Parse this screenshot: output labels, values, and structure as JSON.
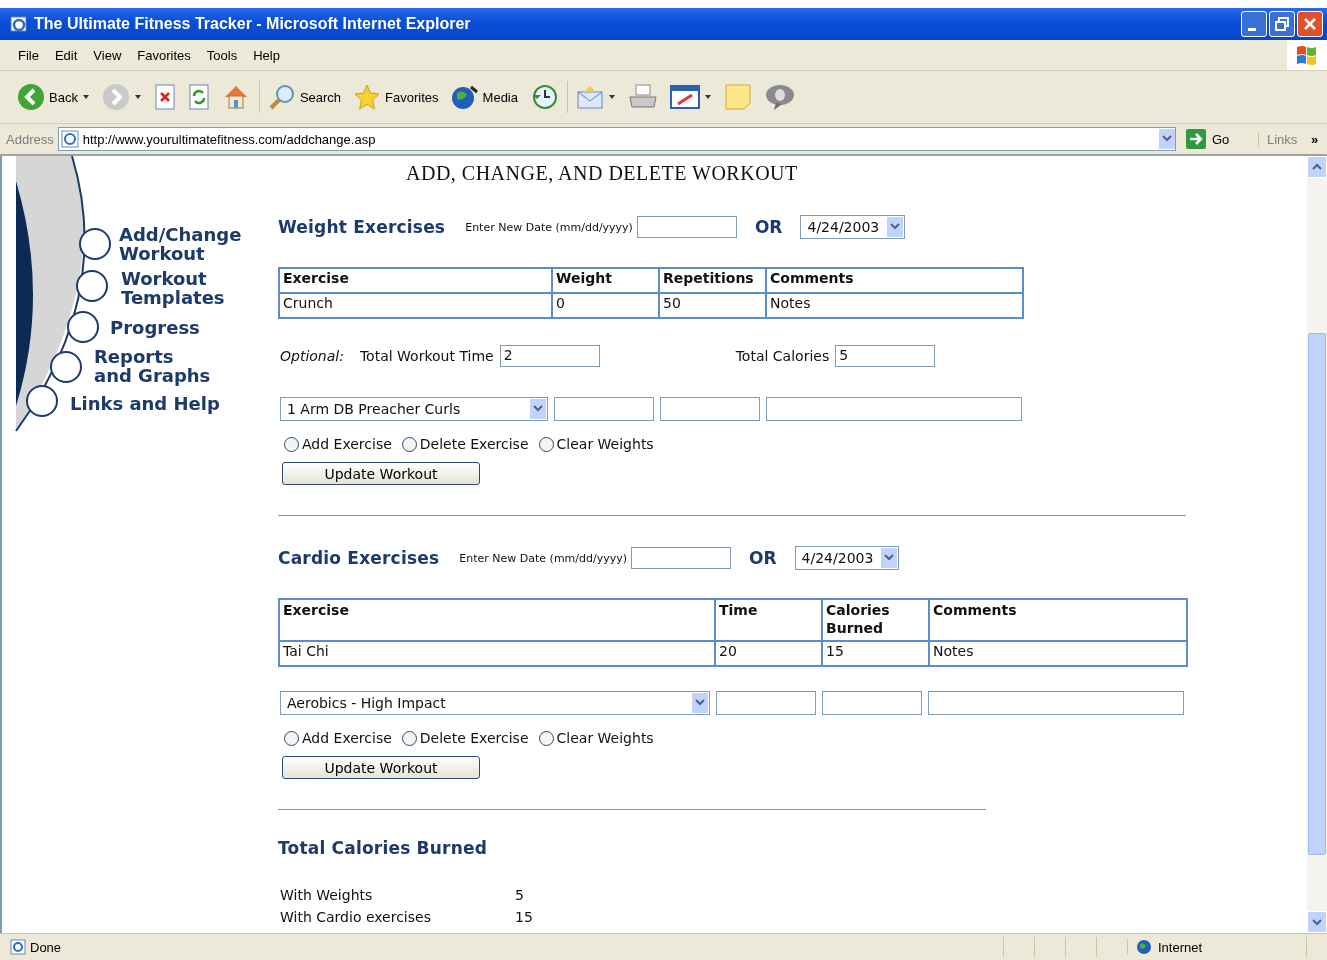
{
  "window": {
    "title": "The Ultimate Fitness Tracker - Microsoft Internet Explorer"
  },
  "menu": [
    "File",
    "Edit",
    "View",
    "Favorites",
    "Tools",
    "Help"
  ],
  "toolbar": [
    {
      "kind": "back",
      "label": "Back",
      "dropdown": true
    },
    {
      "kind": "forward",
      "dropdown": true
    },
    {
      "kind": "stop"
    },
    {
      "kind": "refresh"
    },
    {
      "kind": "home"
    },
    {
      "kind": "search",
      "label": "Search"
    },
    {
      "kind": "favorites",
      "label": "Favorites"
    },
    {
      "kind": "media",
      "label": "Media"
    },
    {
      "kind": "history"
    },
    {
      "kind": "mail",
      "dropdown": true
    },
    {
      "kind": "print"
    },
    {
      "kind": "edit",
      "dropdown": true
    },
    {
      "kind": "note"
    },
    {
      "kind": "messenger"
    }
  ],
  "address": {
    "label": "Address",
    "url": "http://www.yourultimatefitness.com/addchange.asp",
    "go": "Go",
    "links": "Links",
    "more": "»"
  },
  "nav": [
    {
      "label": "Add/Change\nWorkout"
    },
    {
      "label": "Workout\nTemplates"
    },
    {
      "label": "Progress"
    },
    {
      "label": "Reports\nand Graphs"
    },
    {
      "label": "Links and Help"
    }
  ],
  "page_title": "ADD, CHANGE, AND DELETE WORKOUT",
  "weight": {
    "heading": "Weight Exercises",
    "date_label": "Enter New Date (mm/dd/yyyy)",
    "or": "OR",
    "date_select": "4/24/2003",
    "columns": [
      "Exercise",
      "Weight",
      "Repetitions",
      "Comments"
    ],
    "rows": [
      [
        "Crunch",
        "0",
        "50",
        "Notes"
      ]
    ],
    "optional": "Optional:",
    "time_label": "Total Workout Time",
    "time_value": "2",
    "calories_label": "Total Calories",
    "calories_value": "5",
    "exercise_select": "1 Arm DB Preacher Curls",
    "actions": [
      {
        "label": "Add Exercise",
        "selected": false
      },
      {
        "label": "Delete Exercise",
        "selected": false
      },
      {
        "label": "Clear Weights",
        "selected": false
      }
    ],
    "button": "Update Workout"
  },
  "cardio": {
    "heading": "Cardio Exercises",
    "date_label": "Enter New Date (mm/dd/yyyy)",
    "or": "OR",
    "date_select": "4/24/2003",
    "columns": [
      "Exercise",
      "Time",
      "Calories\nBurned",
      "Comments"
    ],
    "rows": [
      [
        "Tai Chi",
        "20",
        "15",
        "Notes"
      ]
    ],
    "exercise_select": "Aerobics - High Impact",
    "actions": [
      {
        "label": "Add Exercise",
        "selected": false
      },
      {
        "label": "Delete Exercise",
        "selected": false
      },
      {
        "label": "Clear Weights",
        "selected": false
      }
    ],
    "button": "Update Workout"
  },
  "totals": {
    "heading": "Total Calories Burned",
    "rows": [
      {
        "label": "With Weights",
        "value": "5"
      },
      {
        "label": "With Cardio exercises",
        "value": "15"
      }
    ]
  },
  "status_bar": {
    "text": "Done",
    "zone": "Internet"
  }
}
